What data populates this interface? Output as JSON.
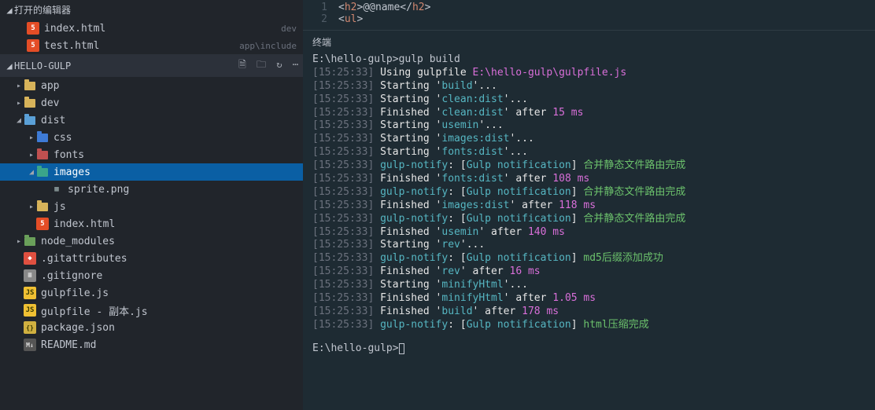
{
  "sidebar": {
    "open_editors_label": "打开的编辑器",
    "open_editors": [
      {
        "name": "index.html",
        "hint": "dev",
        "badge": "5",
        "badgeClass": "badge-html"
      },
      {
        "name": "test.html",
        "hint": "app\\include",
        "badge": "5",
        "badgeClass": "badge-html"
      }
    ],
    "project_label": "HELLO-GULP",
    "actions": [
      "🗎",
      "🗀",
      "↻",
      "⋯"
    ],
    "tree": [
      {
        "indent": 18,
        "arrow": "▸",
        "folderClass": "folder-icon",
        "name": "app"
      },
      {
        "indent": 18,
        "arrow": "▸",
        "folderClass": "folder-icon",
        "name": "dev"
      },
      {
        "indent": 18,
        "arrow": "◢",
        "folderClass": "folder-icon folder-dist",
        "name": "dist"
      },
      {
        "indent": 34,
        "arrow": "▸",
        "folderClass": "folder-icon folder-css",
        "name": "css"
      },
      {
        "indent": 34,
        "arrow": "▸",
        "folderClass": "folder-icon folder-fonts",
        "name": "fonts"
      },
      {
        "indent": 34,
        "arrow": "◢",
        "folderClass": "folder-icon folder-images",
        "name": "images",
        "selected": true
      },
      {
        "indent": 52,
        "arrow": "",
        "fileBadge": "▦",
        "badgeClass": "badge-png",
        "name": "sprite.png"
      },
      {
        "indent": 34,
        "arrow": "▸",
        "folderClass": "folder-icon folder-js",
        "name": "js"
      },
      {
        "indent": 34,
        "arrow": "",
        "fileBadge": "5",
        "badgeClass": "badge-html",
        "name": "index.html"
      },
      {
        "indent": 18,
        "arrow": "▸",
        "folderClass": "folder-icon folder-node",
        "name": "node_modules"
      },
      {
        "indent": 18,
        "arrow": "",
        "fileBadge": "◆",
        "badgeClass": "badge-git",
        "name": ".gitattributes"
      },
      {
        "indent": 18,
        "arrow": "",
        "fileBadge": "≡",
        "badgeClass": "badge-txt",
        "name": ".gitignore"
      },
      {
        "indent": 18,
        "arrow": "",
        "fileBadge": "JS",
        "badgeClass": "badge-js",
        "name": "gulpfile.js"
      },
      {
        "indent": 18,
        "arrow": "",
        "fileBadge": "JS",
        "badgeClass": "badge-js",
        "name": "gulpfile - 副本.js"
      },
      {
        "indent": 18,
        "arrow": "",
        "fileBadge": "{}",
        "badgeClass": "badge-json",
        "name": "package.json"
      },
      {
        "indent": 18,
        "arrow": "",
        "fileBadge": "M↓",
        "badgeClass": "badge-md",
        "name": "README.md"
      }
    ]
  },
  "editor": {
    "lines": [
      {
        "num": "1",
        "html": "<span class='punct'>&lt;</span><span class='tag'>h2</span><span class='punct'>&gt;</span>@@name<span class='punct'>&lt;/</span><span class='tag'>h2</span><span class='punct'>&gt;</span>"
      },
      {
        "num": "2",
        "html": "<span class='punct'>&lt;</span><span class='tag'>ul</span><span class='punct'>&gt;</span>"
      }
    ]
  },
  "terminal": {
    "label": "终端",
    "prompt1": "E:\\hello-gulp>gulp build",
    "prompt2": "E:\\hello-gulp>",
    "lines": [
      {
        "ts": "15:25:33",
        "segs": [
          {
            "t": "Using gulpfile ",
            "c": "t-white"
          },
          {
            "t": "E:\\hello-gulp\\gulpfile.js",
            "c": "t-magenta"
          }
        ]
      },
      {
        "ts": "15:25:33",
        "segs": [
          {
            "t": "Starting '",
            "c": "t-white"
          },
          {
            "t": "build",
            "c": "t-cyan"
          },
          {
            "t": "'...",
            "c": "t-white"
          }
        ]
      },
      {
        "ts": "15:25:33",
        "segs": [
          {
            "t": "Starting '",
            "c": "t-white"
          },
          {
            "t": "clean:dist",
            "c": "t-cyan"
          },
          {
            "t": "'...",
            "c": "t-white"
          }
        ]
      },
      {
        "ts": "15:25:33",
        "segs": [
          {
            "t": "Finished '",
            "c": "t-white"
          },
          {
            "t": "clean:dist",
            "c": "t-cyan"
          },
          {
            "t": "' after ",
            "c": "t-white"
          },
          {
            "t": "15 ms",
            "c": "t-magenta"
          }
        ]
      },
      {
        "ts": "15:25:33",
        "segs": [
          {
            "t": "Starting '",
            "c": "t-white"
          },
          {
            "t": "usemin",
            "c": "t-cyan"
          },
          {
            "t": "'...",
            "c": "t-white"
          }
        ]
      },
      {
        "ts": "15:25:33",
        "segs": [
          {
            "t": "Starting '",
            "c": "t-white"
          },
          {
            "t": "images:dist",
            "c": "t-cyan"
          },
          {
            "t": "'...",
            "c": "t-white"
          }
        ]
      },
      {
        "ts": "15:25:33",
        "segs": [
          {
            "t": "Starting '",
            "c": "t-white"
          },
          {
            "t": "fonts:dist",
            "c": "t-cyan"
          },
          {
            "t": "'...",
            "c": "t-white"
          }
        ]
      },
      {
        "ts": "15:25:33",
        "segs": [
          {
            "t": "gulp-notify",
            "c": "t-cyan"
          },
          {
            "t": ": [",
            "c": "t-white"
          },
          {
            "t": "Gulp notification",
            "c": "t-cyan"
          },
          {
            "t": "] ",
            "c": "t-white"
          },
          {
            "t": "合并静态文件路由完成",
            "c": "t-green"
          }
        ]
      },
      {
        "ts": "15:25:33",
        "segs": [
          {
            "t": "Finished '",
            "c": "t-white"
          },
          {
            "t": "fonts:dist",
            "c": "t-cyan"
          },
          {
            "t": "' after ",
            "c": "t-white"
          },
          {
            "t": "108 ms",
            "c": "t-magenta"
          }
        ]
      },
      {
        "ts": "15:25:33",
        "segs": [
          {
            "t": "gulp-notify",
            "c": "t-cyan"
          },
          {
            "t": ": [",
            "c": "t-white"
          },
          {
            "t": "Gulp notification",
            "c": "t-cyan"
          },
          {
            "t": "] ",
            "c": "t-white"
          },
          {
            "t": "合并静态文件路由完成",
            "c": "t-green"
          }
        ]
      },
      {
        "ts": "15:25:33",
        "segs": [
          {
            "t": "Finished '",
            "c": "t-white"
          },
          {
            "t": "images:dist",
            "c": "t-cyan"
          },
          {
            "t": "' after ",
            "c": "t-white"
          },
          {
            "t": "118 ms",
            "c": "t-magenta"
          }
        ]
      },
      {
        "ts": "15:25:33",
        "segs": [
          {
            "t": "gulp-notify",
            "c": "t-cyan"
          },
          {
            "t": ": [",
            "c": "t-white"
          },
          {
            "t": "Gulp notification",
            "c": "t-cyan"
          },
          {
            "t": "] ",
            "c": "t-white"
          },
          {
            "t": "合并静态文件路由完成",
            "c": "t-green"
          }
        ]
      },
      {
        "ts": "15:25:33",
        "segs": [
          {
            "t": "Finished '",
            "c": "t-white"
          },
          {
            "t": "usemin",
            "c": "t-cyan"
          },
          {
            "t": "' after ",
            "c": "t-white"
          },
          {
            "t": "140 ms",
            "c": "t-magenta"
          }
        ]
      },
      {
        "ts": "15:25:33",
        "segs": [
          {
            "t": "Starting '",
            "c": "t-white"
          },
          {
            "t": "rev",
            "c": "t-cyan"
          },
          {
            "t": "'...",
            "c": "t-white"
          }
        ]
      },
      {
        "ts": "15:25:33",
        "segs": [
          {
            "t": "gulp-notify",
            "c": "t-cyan"
          },
          {
            "t": ": [",
            "c": "t-white"
          },
          {
            "t": "Gulp notification",
            "c": "t-cyan"
          },
          {
            "t": "] ",
            "c": "t-white"
          },
          {
            "t": "md5后缀添加成功",
            "c": "t-green"
          }
        ]
      },
      {
        "ts": "15:25:33",
        "segs": [
          {
            "t": "Finished '",
            "c": "t-white"
          },
          {
            "t": "rev",
            "c": "t-cyan"
          },
          {
            "t": "' after ",
            "c": "t-white"
          },
          {
            "t": "16 ms",
            "c": "t-magenta"
          }
        ]
      },
      {
        "ts": "15:25:33",
        "segs": [
          {
            "t": "Starting '",
            "c": "t-white"
          },
          {
            "t": "minifyHtml",
            "c": "t-cyan"
          },
          {
            "t": "'...",
            "c": "t-white"
          }
        ]
      },
      {
        "ts": "15:25:33",
        "segs": [
          {
            "t": "Finished '",
            "c": "t-white"
          },
          {
            "t": "minifyHtml",
            "c": "t-cyan"
          },
          {
            "t": "' after ",
            "c": "t-white"
          },
          {
            "t": "1.05 ms",
            "c": "t-magenta"
          }
        ]
      },
      {
        "ts": "15:25:33",
        "segs": [
          {
            "t": "Finished '",
            "c": "t-white"
          },
          {
            "t": "build",
            "c": "t-cyan"
          },
          {
            "t": "' after ",
            "c": "t-white"
          },
          {
            "t": "178 ms",
            "c": "t-magenta"
          }
        ]
      },
      {
        "ts": "15:25:33",
        "segs": [
          {
            "t": "gulp-notify",
            "c": "t-cyan"
          },
          {
            "t": ": [",
            "c": "t-white"
          },
          {
            "t": "Gulp notification",
            "c": "t-cyan"
          },
          {
            "t": "] ",
            "c": "t-white"
          },
          {
            "t": "html压缩完成",
            "c": "t-green"
          }
        ]
      }
    ]
  }
}
